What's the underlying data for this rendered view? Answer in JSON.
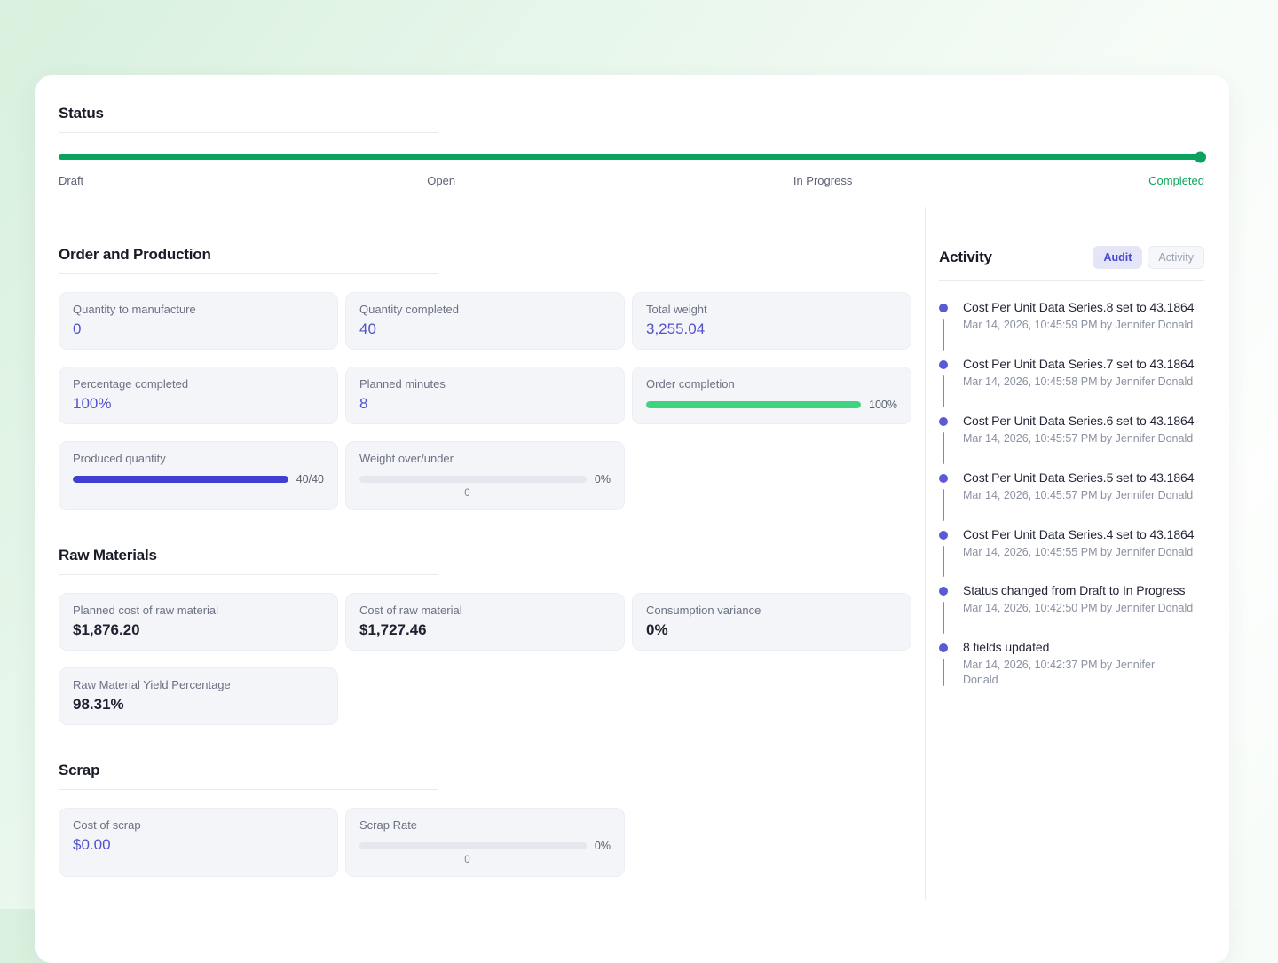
{
  "colors": {
    "status_bar": "#0aa35e",
    "completed_text": "#12a35f",
    "completion_bar": "#3ed47f",
    "produced_bar": "#413fd1",
    "accent_value": "#5351cb",
    "timeline_dot": "#5b59d6"
  },
  "status": {
    "title": "Status",
    "progress_percent": 100,
    "steps": [
      "Draft",
      "Open",
      "In Progress",
      "Completed"
    ],
    "current_step": "Completed"
  },
  "order_production": {
    "title": "Order and Production",
    "cards": [
      {
        "label": "Quantity to manufacture",
        "value": "0"
      },
      {
        "label": "Quantity completed",
        "value": "40"
      },
      {
        "label": "Total weight",
        "value": "3,255.04"
      },
      {
        "label": "Percentage completed",
        "value": "100%"
      },
      {
        "label": "Planned minutes",
        "value": "8"
      },
      {
        "label": "Order completion",
        "progress_percent": 100,
        "progress_label": "100%"
      },
      {
        "label": "Produced quantity",
        "progress_percent": 100,
        "progress_label": "40/40"
      },
      {
        "label": "Weight over/under",
        "progress_percent": 0,
        "progress_label": "0%",
        "progress_sublabel": "0"
      }
    ]
  },
  "raw_materials": {
    "title": "Raw Materials",
    "cards": [
      {
        "label": "Planned cost of raw material",
        "value": "$1,876.20"
      },
      {
        "label": "Cost of raw material",
        "value": "$1,727.46"
      },
      {
        "label": "Consumption variance",
        "value": "0%"
      },
      {
        "label": "Raw Material Yield Percentage",
        "value": "98.31%"
      }
    ]
  },
  "scrap": {
    "title": "Scrap",
    "cards": [
      {
        "label": "Cost of scrap",
        "value": "$0.00"
      },
      {
        "label": "Scrap Rate",
        "progress_percent": 0,
        "progress_label": "0%",
        "progress_sublabel": "0"
      }
    ]
  },
  "activity": {
    "title": "Activity",
    "tabs": [
      {
        "label": "Audit",
        "active": true
      },
      {
        "label": "Activity",
        "active": false
      }
    ],
    "items": [
      {
        "title": "Cost Per Unit Data Series.8 set to 43.1864",
        "timestamp": "Mar 14, 2026, 10:45:59 PM by Jennifer Donald"
      },
      {
        "title": "Cost Per Unit Data Series.7 set to 43.1864",
        "timestamp": "Mar 14, 2026, 10:45:58 PM by Jennifer Donald"
      },
      {
        "title": "Cost Per Unit Data Series.6 set to 43.1864",
        "timestamp": "Mar 14, 2026, 10:45:57 PM by Jennifer Donald"
      },
      {
        "title": "Cost Per Unit Data Series.5 set to 43.1864",
        "timestamp": "Mar 14, 2026, 10:45:57 PM by Jennifer Donald"
      },
      {
        "title": "Cost Per Unit Data Series.4 set to 43.1864",
        "timestamp": "Mar 14, 2026, 10:45:55 PM by Jennifer Donald"
      },
      {
        "title": "Status changed from Draft to In Progress",
        "timestamp": "Mar 14, 2026, 10:42:50 PM by Jennifer Donald"
      },
      {
        "title": "8 fields updated",
        "timestamp": "Mar 14, 2026, 10:42:37 PM by Jennifer Donald"
      }
    ]
  }
}
